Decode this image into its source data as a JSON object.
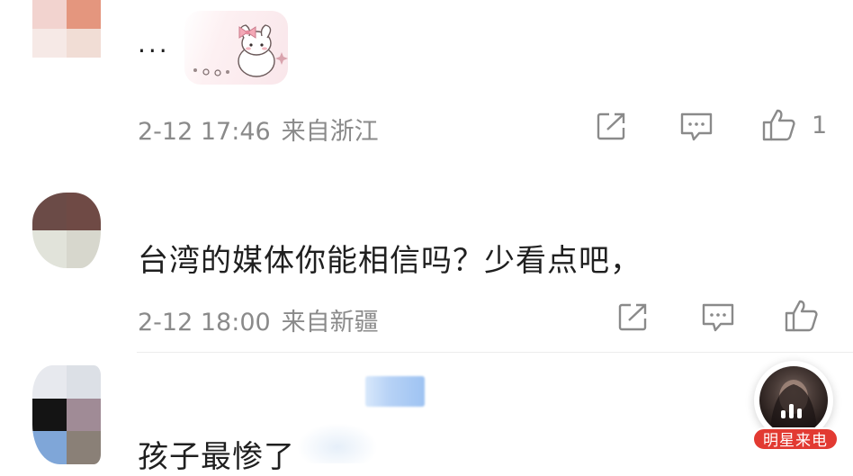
{
  "comments": [
    {
      "text": "...",
      "date": "2-12 17:46",
      "location": "来自浙江",
      "like_count": "1",
      "avatar_colors": [
        "#f2d3cf",
        "#e4967e",
        "#f6e9e6",
        "#f1ddd5"
      ]
    },
    {
      "text": "台湾的媒体你能相信吗？少看点吧，",
      "date": "2-12 18:00",
      "location": "来自新疆",
      "avatar_colors": [
        "#6b4b47",
        "#6f4a45",
        "#e1e3da",
        "#d7d7cd"
      ]
    },
    {
      "text": "孩子最惨了",
      "avatar_colors": [
        "#e7e9ee",
        "#dce0e6",
        "#141414",
        "#a08b96",
        "#7fa6d8",
        "#8a8077"
      ]
    }
  ],
  "call_widget": {
    "label": "明星来电"
  },
  "icons": {
    "share": "share-icon",
    "comment": "comment-icon",
    "like": "thumbs-up-icon",
    "sticker": "bunny-sticker-icon"
  },
  "colors": {
    "meta_text": "#8a8a8a",
    "accent_red": "#e23a32"
  }
}
